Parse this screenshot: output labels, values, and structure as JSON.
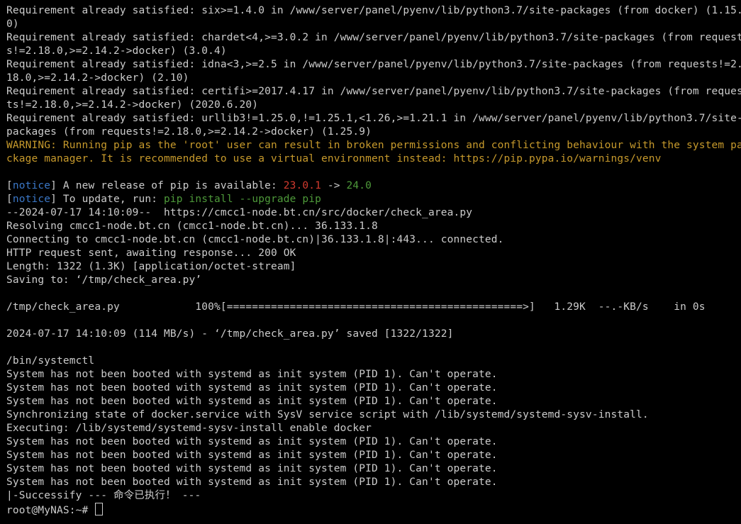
{
  "colors": {
    "background": "#000000",
    "foreground": "#cccccc",
    "warning": "#c79a2c",
    "notice_tag": "#3b78c8",
    "version_old": "#d13a2e",
    "version_new": "#4e9a3a"
  },
  "lines": [
    {
      "segs": [
        {
          "t": "Requirement already satisfied: six>=1.4.0 in /www/server/panel/pyenv/lib/python3.7/site-packages (from docker) (1.15."
        }
      ]
    },
    {
      "segs": [
        {
          "t": "0)"
        }
      ]
    },
    {
      "segs": [
        {
          "t": "Requirement already satisfied: chardet<4,>=3.0.2 in /www/server/panel/pyenv/lib/python3.7/site-packages (from request"
        }
      ]
    },
    {
      "segs": [
        {
          "t": "s!=2.18.0,>=2.14.2->docker) (3.0.4)"
        }
      ]
    },
    {
      "segs": [
        {
          "t": "Requirement already satisfied: idna<3,>=2.5 in /www/server/panel/pyenv/lib/python3.7/site-packages (from requests!=2."
        }
      ]
    },
    {
      "segs": [
        {
          "t": "18.0,>=2.14.2->docker) (2.10)"
        }
      ]
    },
    {
      "segs": [
        {
          "t": "Requirement already satisfied: certifi>=2017.4.17 in /www/server/panel/pyenv/lib/python3.7/site-packages (from reques"
        }
      ]
    },
    {
      "segs": [
        {
          "t": "ts!=2.18.0,>=2.14.2->docker) (2020.6.20)"
        }
      ]
    },
    {
      "segs": [
        {
          "t": "Requirement already satisfied: urllib3!=1.25.0,!=1.25.1,<1.26,>=1.21.1 in /www/server/panel/pyenv/lib/python3.7/site-"
        }
      ]
    },
    {
      "segs": [
        {
          "t": "packages (from requests!=2.18.0,>=2.14.2->docker) (1.25.9)"
        }
      ]
    },
    {
      "segs": [
        {
          "t": "WARNING: Running pip as the 'root' user can result in broken permissions and conflicting behaviour with the system pa",
          "c": "warning"
        }
      ]
    },
    {
      "segs": [
        {
          "t": "ckage manager. It is recommended to use a virtual environment instead: https://pip.pypa.io/warnings/venv",
          "c": "warning"
        }
      ]
    },
    {
      "segs": [
        {
          "t": ""
        }
      ]
    },
    {
      "segs": [
        {
          "t": "["
        },
        {
          "t": "notice",
          "c": "notice_tag"
        },
        {
          "t": "] A new release of pip is available: "
        },
        {
          "t": "23.0.1",
          "c": "version_old"
        },
        {
          "t": " -> "
        },
        {
          "t": "24.0",
          "c": "version_new"
        }
      ]
    },
    {
      "segs": [
        {
          "t": "["
        },
        {
          "t": "notice",
          "c": "notice_tag"
        },
        {
          "t": "] To update, run: "
        },
        {
          "t": "pip install --upgrade pip",
          "c": "version_new"
        }
      ]
    },
    {
      "segs": [
        {
          "t": "--2024-07-17 14:10:09--  https://cmcc1-node.bt.cn/src/docker/check_area.py"
        }
      ]
    },
    {
      "segs": [
        {
          "t": "Resolving cmcc1-node.bt.cn (cmcc1-node.bt.cn)... 36.133.1.8"
        }
      ]
    },
    {
      "segs": [
        {
          "t": "Connecting to cmcc1-node.bt.cn (cmcc1-node.bt.cn)|36.133.1.8|:443... connected."
        }
      ]
    },
    {
      "segs": [
        {
          "t": "HTTP request sent, awaiting response... 200 OK"
        }
      ]
    },
    {
      "segs": [
        {
          "t": "Length: 1322 (1.3K) [application/octet-stream]"
        }
      ]
    },
    {
      "segs": [
        {
          "t": "Saving to: ‘/tmp/check_area.py’"
        }
      ]
    },
    {
      "segs": [
        {
          "t": ""
        }
      ]
    },
    {
      "segs": [
        {
          "t": "/tmp/check_area.py            100%[===============================================>]   1.29K  --.-KB/s    in 0s"
        }
      ]
    },
    {
      "segs": [
        {
          "t": ""
        }
      ]
    },
    {
      "segs": [
        {
          "t": "2024-07-17 14:10:09 (114 MB/s) - ‘/tmp/check_area.py’ saved [1322/1322]"
        }
      ]
    },
    {
      "segs": [
        {
          "t": ""
        }
      ]
    },
    {
      "segs": [
        {
          "t": "/bin/systemctl"
        }
      ]
    },
    {
      "segs": [
        {
          "t": "System has not been booted with systemd as init system (PID 1). Can't operate."
        }
      ]
    },
    {
      "segs": [
        {
          "t": "System has not been booted with systemd as init system (PID 1). Can't operate."
        }
      ]
    },
    {
      "segs": [
        {
          "t": "System has not been booted with systemd as init system (PID 1). Can't operate."
        }
      ]
    },
    {
      "segs": [
        {
          "t": "Synchronizing state of docker.service with SysV service script with /lib/systemd/systemd-sysv-install."
        }
      ]
    },
    {
      "segs": [
        {
          "t": "Executing: /lib/systemd/systemd-sysv-install enable docker"
        }
      ]
    },
    {
      "segs": [
        {
          "t": "System has not been booted with systemd as init system (PID 1). Can't operate."
        }
      ]
    },
    {
      "segs": [
        {
          "t": "System has not been booted with systemd as init system (PID 1). Can't operate."
        }
      ]
    },
    {
      "segs": [
        {
          "t": "System has not been booted with systemd as init system (PID 1). Can't operate."
        }
      ]
    },
    {
      "segs": [
        {
          "t": "System has not been booted with systemd as init system (PID 1). Can't operate."
        }
      ]
    },
    {
      "segs": [
        {
          "t": "|-Successify --- 命令已执行！ ---"
        }
      ]
    }
  ],
  "prompt": "root@MyNAS:~# "
}
